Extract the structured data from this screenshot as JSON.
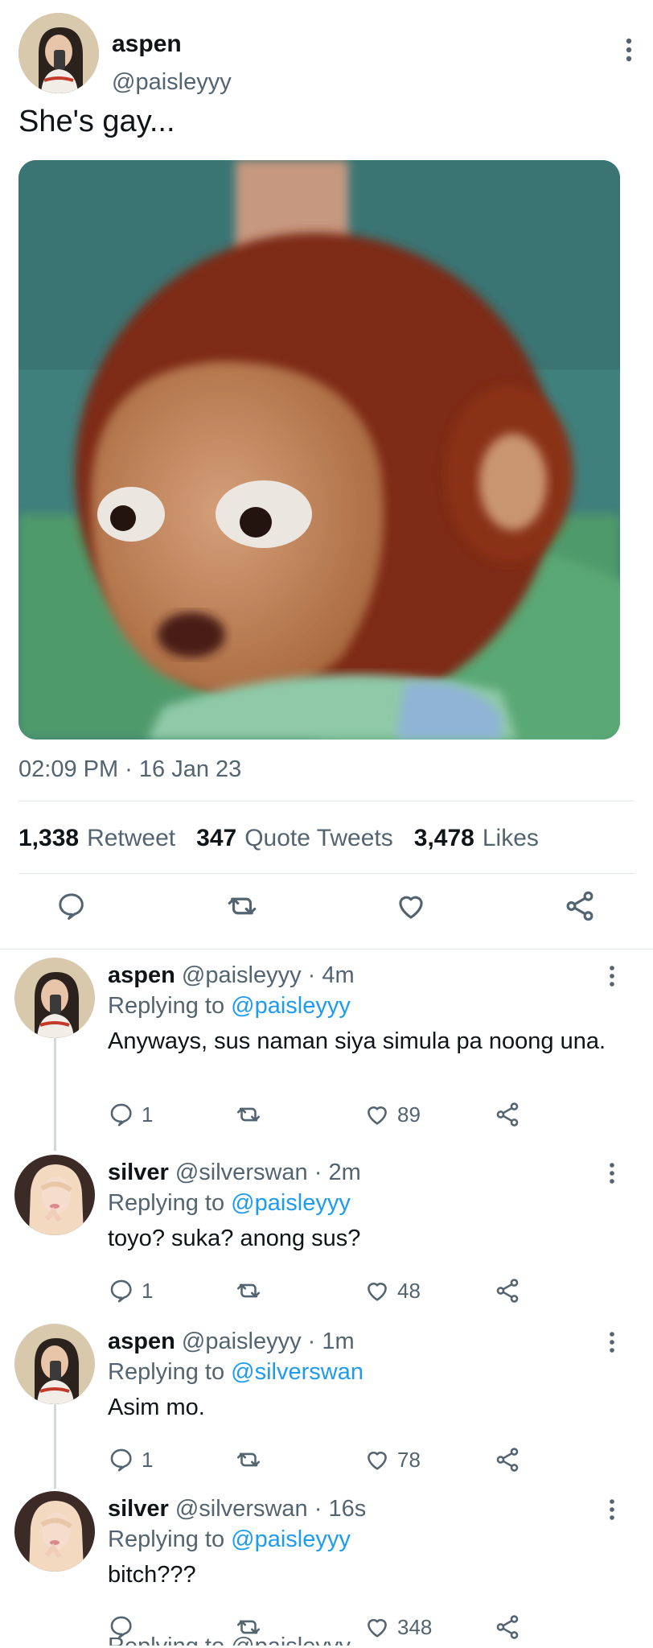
{
  "tweet": {
    "author_name": "aspen",
    "author_handle": "@paisleyyy",
    "text": "She's gay...",
    "timestamp": "02:09 PM · 16 Jan 23",
    "stats": {
      "retweets_count": "1,338",
      "retweets_label": "Retweet",
      "quotes_count": "347",
      "quotes_label": "Quote Tweets",
      "likes_count": "3,478",
      "likes_label": "Likes"
    }
  },
  "replies": [
    {
      "name": "aspen",
      "handle": "@paisleyyy",
      "time": "· 4m",
      "replying_label": "Replying to",
      "replying_to": "@paisleyyy",
      "text": "Anyways, sus naman siya simula pa noong una.",
      "reply_count": "1",
      "like_count": "89",
      "avatar": "aspen"
    },
    {
      "name": "silver",
      "handle": "@silverswan",
      "time": "· 2m",
      "replying_label": "Replying to",
      "replying_to": "@paisleyyy",
      "text": "toyo? suka? anong sus?",
      "reply_count": "1",
      "like_count": "48",
      "avatar": "silver"
    },
    {
      "name": "aspen",
      "handle": "@paisleyyy",
      "time": "· 1m",
      "replying_label": "Replying to",
      "replying_to": "@silverswan",
      "text": "Asim mo.",
      "reply_count": "1",
      "like_count": "78",
      "avatar": "aspen"
    },
    {
      "name": "silver",
      "handle": "@silverswan",
      "time": "· 16s",
      "replying_label": "Replying to",
      "replying_to": "@paisleyyy",
      "text": "bitch???",
      "reply_count": "",
      "like_count": "348",
      "avatar": "silver"
    }
  ],
  "partial_next": "Replying to @paisleyyy",
  "colors": {
    "accent": "#1d9bf0",
    "text": "#0f1419",
    "muted": "#536471",
    "divider": "#e1e6ea",
    "thread_line": "#cfd9de"
  },
  "icons": {
    "reply": "speech-bubble-icon",
    "retweet": "retweet-icon",
    "like": "heart-icon",
    "share": "share-icon",
    "more": "more-vertical-icon"
  }
}
